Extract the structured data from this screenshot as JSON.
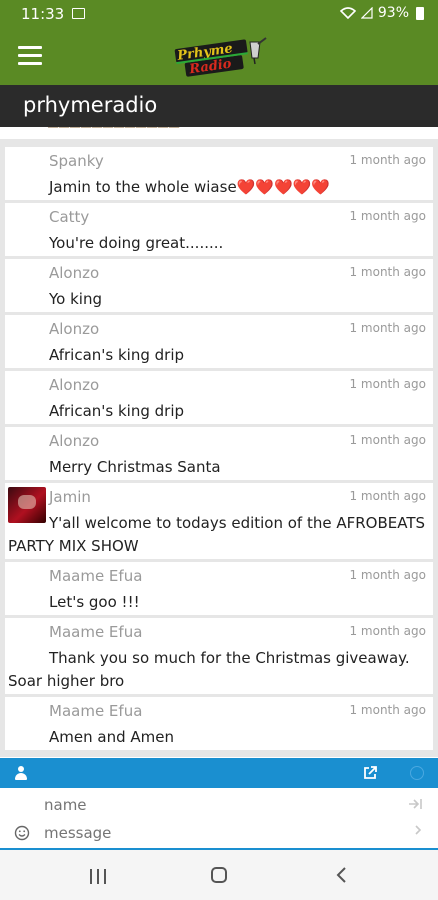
{
  "status_bar": {
    "time": "11:33",
    "battery": "93%"
  },
  "app_bar": {
    "logo_text": "Prhyme Radio"
  },
  "title_bar": {
    "title": "prhymeradio"
  },
  "messages": [
    {
      "author": "Spanky",
      "time": "1 month ago",
      "text": "Jamin to the whole wiase❤️❤️❤️❤️❤️"
    },
    {
      "author": "Catty",
      "time": "1 month ago",
      "text": "You're doing great........"
    },
    {
      "author": "Alonzo",
      "time": "1 month ago",
      "text": "Yo king"
    },
    {
      "author": "Alonzo",
      "time": "1 month ago",
      "text": "African's king drip"
    },
    {
      "author": "Alonzo",
      "time": "1 month ago",
      "text": "African's king drip"
    },
    {
      "author": "Alonzo",
      "time": "1 month ago",
      "text": "Merry Christmas Santa"
    },
    {
      "author": "Jamin",
      "time": "1 month ago",
      "text": "Y'all welcome to todays edition of the AFROBEATS PARTY MIX SHOW",
      "has_avatar": true
    },
    {
      "author": "Maame Efua",
      "time": "1 month ago",
      "text": "Let's goo !!!"
    },
    {
      "author": "Maame Efua",
      "time": "1 month ago",
      "text": "Thank you so much for the Christmas giveaway. Soar higher bro"
    },
    {
      "author": "Maame Efua",
      "time": "1 month ago",
      "text": "Amen and Amen"
    }
  ],
  "chat_input": {
    "name_placeholder": "name",
    "message_placeholder": "message"
  },
  "icons": {
    "menu": "hamburger-icon",
    "user": "user-icon",
    "external": "external-link-icon",
    "emoji": "smile-icon",
    "send": "enter-icon",
    "home": "home-icon",
    "back": "back-icon",
    "recent": "recent-apps-icon"
  },
  "colors": {
    "app_green": "#5a8a24",
    "title_dark": "#2b2b2b",
    "chat_blue": "#1a8fd0"
  }
}
